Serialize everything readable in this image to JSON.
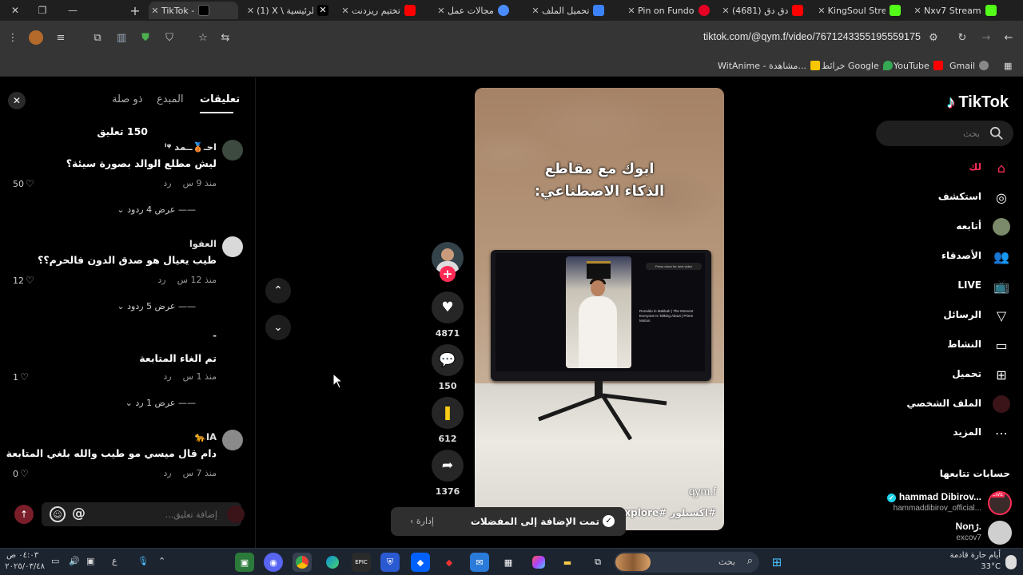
{
  "browser": {
    "tabs": [
      {
        "title": "TikTok - ",
        "favicon": "tiktok-icon",
        "color": "#000000",
        "active": true
      },
      {
        "title": "(1) X \\ الرئيسية",
        "favicon": "x-icon",
        "color": "#000000"
      },
      {
        "title": "تختيم ريزدنت",
        "favicon": "youtube-icon",
        "color": "#ff0000"
      },
      {
        "title": "مجالات عمل",
        "favicon": "gemini-icon",
        "color": "#4a8bff"
      },
      {
        "title": "تحميل الملف",
        "favicon": "heart-icon",
        "color": "#3b82f6"
      },
      {
        "title": "Pin on Fundo",
        "favicon": "pinterest-icon",
        "color": "#e60023"
      },
      {
        "title": "(4681) دق دق",
        "favicon": "youtube-icon",
        "color": "#ff0000"
      },
      {
        "title": "KingSoul Stre",
        "favicon": "kick-icon",
        "color": "#53fc18"
      },
      {
        "title": "Nxv7 Stream",
        "favicon": "kick-icon",
        "color": "#53fc18"
      }
    ],
    "url": "tiktok.com/@qym.f/video/7671243355195559175",
    "bookmarks": [
      {
        "label": "Gmail",
        "color": "#ea4335"
      },
      {
        "label": "YouTube",
        "color": "#ff0000"
      },
      {
        "label": "خرائط Google",
        "color": "#34a853"
      },
      {
        "label": "WitAnime - مشاهدة...",
        "color": "#f7c600"
      }
    ]
  },
  "comments_panel": {
    "tabs": [
      "تعليقات",
      "المبدع",
      "ذو صلة"
    ],
    "active_tab": "تعليقات",
    "count_label": "150 تعليق",
    "comments": [
      {
        "user": "احـ🥉ــمد ᴵᵠ",
        "text": "ليش مطلع الوالد بصورة سيئة؟",
        "time": "منذ 9 س",
        "reply": "رد",
        "likes": "50",
        "replies": "عرض 4 ردود"
      },
      {
        "user": "العفوا",
        "text": "طيب يعيال هو صدق الدون فالحرم؟؟",
        "time": "منذ 12 س",
        "reply": "رد",
        "likes": "12",
        "replies": "عرض 5 ردود"
      },
      {
        "user": "-",
        "text": "تم الغاء المتابعة",
        "time": "منذ 1 س",
        "reply": "رد",
        "likes": "1",
        "replies": "عرض 1 رد"
      },
      {
        "user": "IA🐆",
        "text": "دام قال ميسي مو طيب والله بلغي المتابعة",
        "time": "منذ 7 س",
        "reply": "رد",
        "likes": "0",
        "replies": ""
      }
    ],
    "input_placeholder": "إضافة تعليق..."
  },
  "video": {
    "caption_line1": "ابوك مع مقاطع",
    "caption_line2": "الذكاء الاصطناعي:",
    "creator": "qym.f",
    "hashtags": "#اكسبلور #explore #تر",
    "screen_title": "Ronaldo in Makkah | The Moment Everyone Is Talking About | Prime Motion",
    "screen_next": "Press down for next video"
  },
  "actions": {
    "likes": "4871",
    "comments": "150",
    "saves": "612",
    "shares": "1376"
  },
  "toast": {
    "message": "تمت الإضافة إلى المفضلات",
    "manage": "إدارة"
  },
  "sidebar": {
    "logo": "TikTok",
    "search_placeholder": "بحث",
    "nav": [
      {
        "label": "لك",
        "icon": "home-icon",
        "active": true
      },
      {
        "label": "استكشف",
        "icon": "compass-icon"
      },
      {
        "label": "أتابعه",
        "icon": "following-avatar-icon"
      },
      {
        "label": "الأصدقاء",
        "icon": "friends-icon"
      },
      {
        "label": "LIVE",
        "icon": "live-icon"
      },
      {
        "label": "الرسائل",
        "icon": "send-icon"
      },
      {
        "label": "النشاط",
        "icon": "activity-icon"
      },
      {
        "label": "تحميل",
        "icon": "upload-icon"
      },
      {
        "label": "الملف الشخصي",
        "icon": "profile-avatar-icon"
      },
      {
        "label": "المزيد",
        "icon": "more-icon"
      }
    ],
    "following_title": "حسابات تتابعها",
    "accounts": [
      {
        "name": "hammad Dibirov...",
        "handle": "hammaddibirov_official...",
        "live": "LIVE"
      },
      {
        "name": "Nonژ.",
        "handle": "excov7"
      }
    ]
  },
  "taskbar": {
    "search_text": "بحث",
    "weather_desc": "أيام حارة قادمة",
    "weather_temp": "33°C",
    "clock_time": "٠٤:٠٣ ص",
    "clock_date": "٢٠٢٥/٠٣/٤٨",
    "lang": "ع"
  }
}
